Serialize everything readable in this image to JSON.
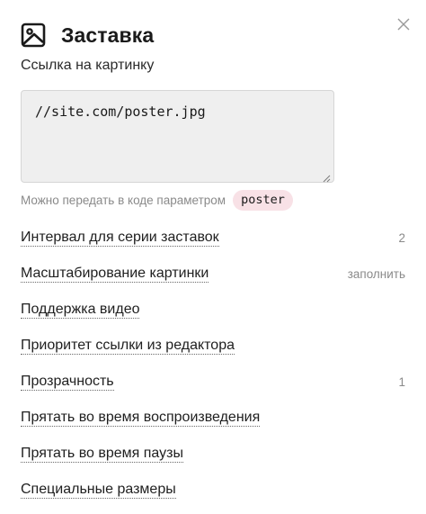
{
  "header": {
    "icon": "image-icon",
    "title": "Заставка",
    "close_icon": "close-icon"
  },
  "poster_field": {
    "label": "Ссылка на картинку",
    "value": "//site.com/poster.jpg",
    "hint": "Можно передать в коде параметром",
    "param": "poster"
  },
  "settings": [
    {
      "label": "Интервал для серии заставок",
      "value": "2"
    },
    {
      "label": "Масштабирование картинки",
      "value": "заполнить"
    },
    {
      "label": "Поддержка видео",
      "value": ""
    },
    {
      "label": "Приоритет ссылки из редактора",
      "value": ""
    },
    {
      "label": "Прозрачность",
      "value": "1"
    },
    {
      "label": "Прятать во время воспроизведения",
      "value": ""
    },
    {
      "label": "Прятать во время паузы",
      "value": ""
    },
    {
      "label": "Специальные размеры",
      "value": ""
    }
  ]
}
